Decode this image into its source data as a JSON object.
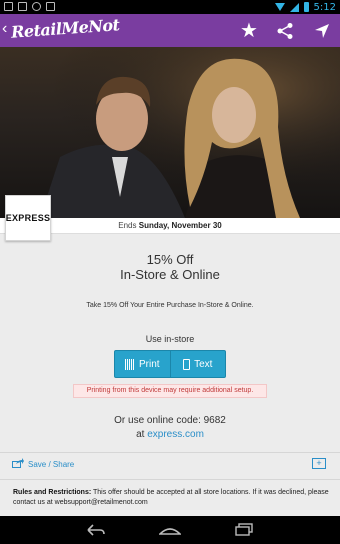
{
  "status_bar": {
    "time": "5:12"
  },
  "app_bar": {
    "logo_text": "RetailMeNot",
    "brand_color": "#7a3da0"
  },
  "hero": {
    "image_desc": ""
  },
  "store": {
    "logo_text": "EXPRESS"
  },
  "date": {
    "prefix": "Ends",
    "value": "Sunday, November 30"
  },
  "deal": {
    "title_line1": "15% Off",
    "title_line2": "In-Store & Online",
    "description": "Take 15% Off Your Entire Purchase In-Store & Online.",
    "use_label": "Use in-store",
    "print_label": "Print",
    "text_label": "Text",
    "warning": "Printing from this device may require additional setup.",
    "code_prefix": "Or use online code:",
    "code": "9682",
    "at_label": "at",
    "site": "express.com"
  },
  "save_share": {
    "label": "Save / Share",
    "plus": "+"
  },
  "rules": {
    "title": "Rules and Restrictions:",
    "text": "This offer should be accepted at all store locations. If it was declined, please contact us at websupport@retailmenot.com"
  },
  "colors": {
    "accent": "#28a3cc",
    "link": "#2a8ec8",
    "warning_bg": "#fde7e7",
    "warning_text": "#c03a3a"
  }
}
